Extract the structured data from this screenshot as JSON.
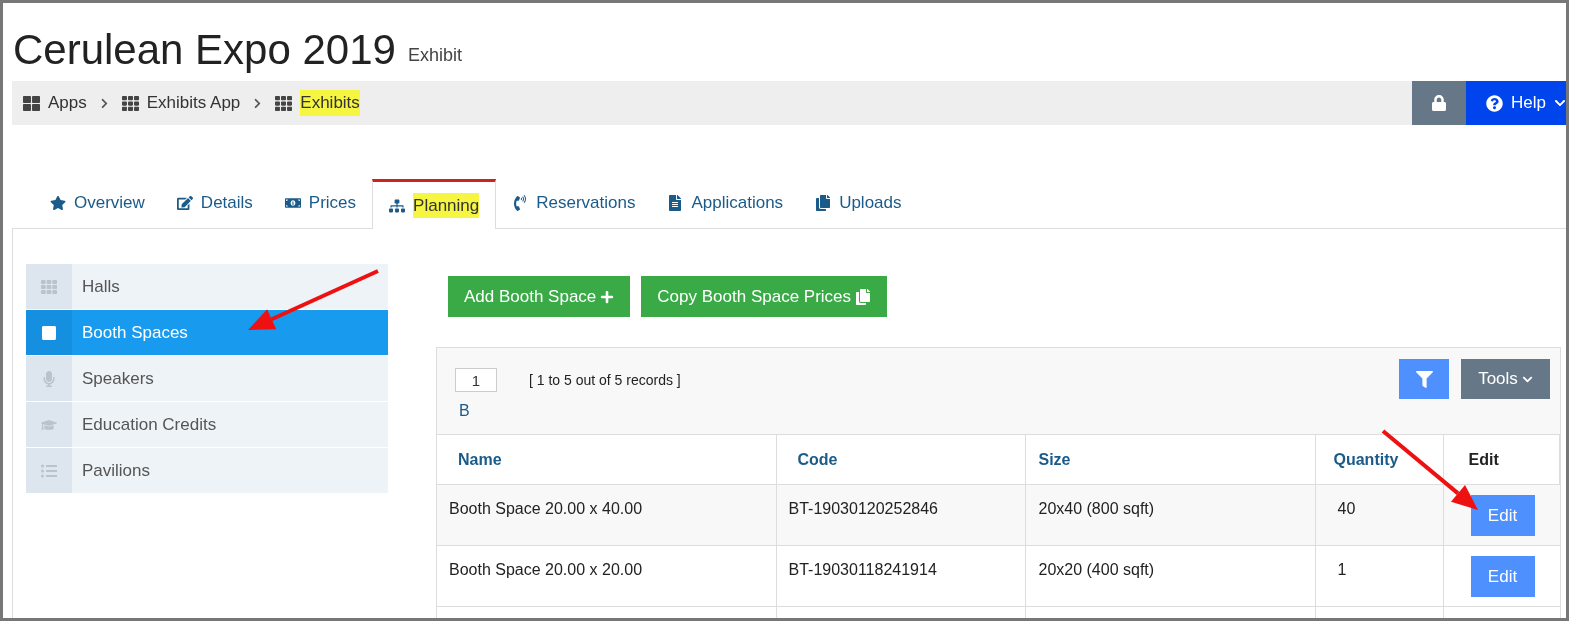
{
  "header": {
    "title": "Cerulean Expo 2019",
    "subtitle": "Exhibit"
  },
  "breadcrumbs": [
    {
      "label": "Apps",
      "highlighted": false
    },
    {
      "label": "Exhibits App",
      "highlighted": false
    },
    {
      "label": "Exhibits",
      "highlighted": true
    }
  ],
  "help_button": {
    "label": "Help"
  },
  "tabs": [
    {
      "label": "Overview",
      "selected": false,
      "highlighted": false
    },
    {
      "label": "Details",
      "selected": false,
      "highlighted": false
    },
    {
      "label": "Prices",
      "selected": false,
      "highlighted": false
    },
    {
      "label": "Planning",
      "selected": true,
      "highlighted": true
    },
    {
      "label": "Reservations",
      "selected": false,
      "highlighted": false
    },
    {
      "label": "Applications",
      "selected": false,
      "highlighted": false
    },
    {
      "label": "Uploads",
      "selected": false,
      "highlighted": false
    }
  ],
  "sidebar": {
    "items": [
      {
        "label": "Halls",
        "selected": false
      },
      {
        "label": "Booth Spaces",
        "selected": true
      },
      {
        "label": "Speakers",
        "selected": false
      },
      {
        "label": "Education Credits",
        "selected": false
      },
      {
        "label": "Pavilions",
        "selected": false
      }
    ]
  },
  "actions": [
    "Add Booth Space",
    "Copy Booth Space Prices"
  ],
  "pager": {
    "page": "1",
    "summary": "[ 1 to 5 out of 5 records ]",
    "link": "B"
  },
  "tools_button": {
    "label": "Tools"
  },
  "table": {
    "columns": [
      "Name",
      "Code",
      "Size",
      "Quantity",
      "Edit"
    ],
    "rows": [
      {
        "cells": [
          "Booth Space 20.00 x 40.00",
          "BT-19030120252846",
          "20x40 (800 sqft)",
          "40"
        ],
        "action": "Edit"
      },
      {
        "cells": [
          "Booth Space 20.00 x 20.00",
          "BT-19030118241914",
          "20x20 (400 sqft)",
          "1"
        ],
        "action": "Edit"
      }
    ]
  }
}
